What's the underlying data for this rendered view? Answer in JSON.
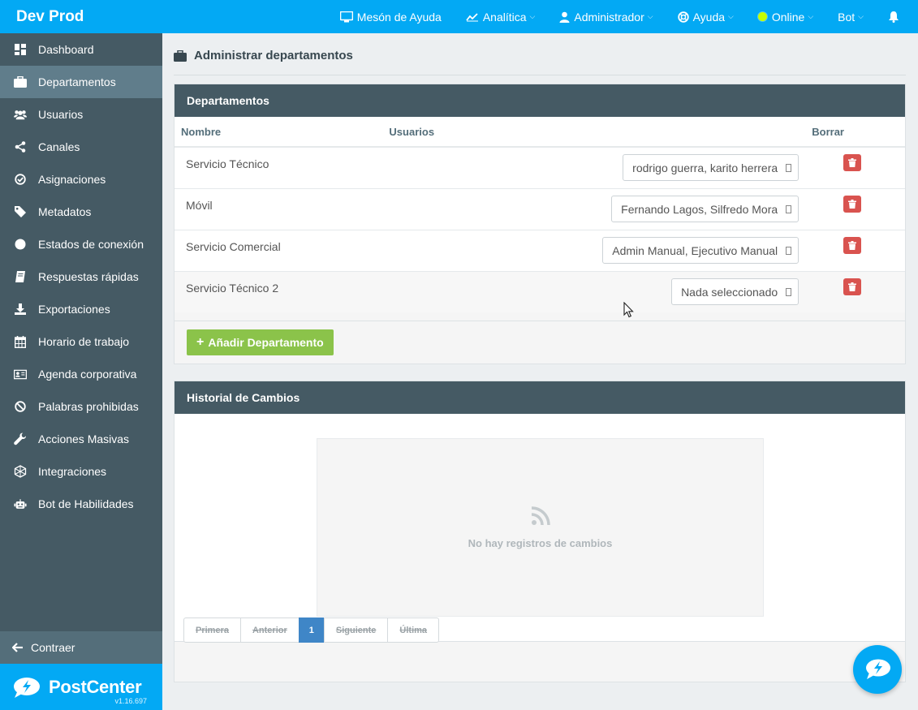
{
  "brand": "Dev Prod",
  "topnav": {
    "help_desk": "Mesón de Ayuda",
    "analytics": "Analítica",
    "admin": "Administrador",
    "help": "Ayuda",
    "status": "Online",
    "bot": "Bot"
  },
  "sidebar": {
    "items": [
      {
        "label": "Dashboard",
        "icon": "dashboard-icon"
      },
      {
        "label": "Departamentos",
        "icon": "briefcase-icon"
      },
      {
        "label": "Usuarios",
        "icon": "users-icon"
      },
      {
        "label": "Canales",
        "icon": "share-icon"
      },
      {
        "label": "Asignaciones",
        "icon": "check-circle-icon"
      },
      {
        "label": "Metadatos",
        "icon": "tag-icon"
      },
      {
        "label": "Estados de conexión",
        "icon": "circle-icon"
      },
      {
        "label": "Respuestas rápidas",
        "icon": "book-icon"
      },
      {
        "label": "Exportaciones",
        "icon": "download-icon"
      },
      {
        "label": "Horario de trabajo",
        "icon": "calendar-icon"
      },
      {
        "label": "Agenda corporativa",
        "icon": "id-card-icon"
      },
      {
        "label": "Palabras prohibidas",
        "icon": "ban-icon"
      },
      {
        "label": "Acciones Masivas",
        "icon": "wrench-icon"
      },
      {
        "label": "Integraciones",
        "icon": "network-icon"
      },
      {
        "label": "Bot de Habilidades",
        "icon": "robot-icon"
      }
    ],
    "collapse": "Contraer",
    "logo": "PostCenter",
    "version": "v1.16.697"
  },
  "page": {
    "title": "Administrar departamentos"
  },
  "departments": {
    "panel_title": "Departamentos",
    "columns": {
      "name": "Nombre",
      "users": "Usuarios",
      "delete": "Borrar"
    },
    "rows": [
      {
        "name": "Servicio Técnico",
        "users": "rodrigo guerra,  karito herrera"
      },
      {
        "name": "Móvil",
        "users": "Fernando Lagos,  Silfredo Mora"
      },
      {
        "name": "Servicio Comercial",
        "users": "Admin Manual,  Ejecutivo Manual"
      },
      {
        "name": "Servicio Técnico 2",
        "users": "Nada seleccionado"
      }
    ],
    "add_button": "Añadir Departamento"
  },
  "history": {
    "panel_title": "Historial de Cambios",
    "empty_message": "No hay registros de cambios",
    "pager": {
      "first": "Primera",
      "prev": "Anterior",
      "current": "1",
      "next": "Siguiente",
      "last": "Última"
    }
  },
  "colors": {
    "primary": "#03a9f4",
    "sidebar": "#455a64",
    "sidebar_active": "#607d8b",
    "success": "#8bc34a",
    "danger": "#d9534f",
    "online": "#c6ff00"
  }
}
